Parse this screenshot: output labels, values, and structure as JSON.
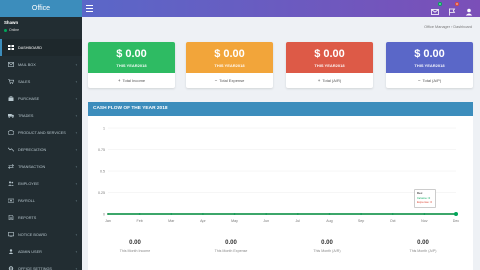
{
  "app": {
    "brand": "Office"
  },
  "user": {
    "name": "Shawn",
    "status": "Online"
  },
  "sidebar": {
    "items": [
      {
        "label": "DASHBOARD",
        "icon": "dashboard-icon",
        "active": true,
        "arrow": ""
      },
      {
        "label": "MAIL BOX",
        "icon": "mail-icon",
        "active": false,
        "arrow": "‹"
      },
      {
        "label": "SALES",
        "icon": "cart-icon",
        "active": false,
        "arrow": "‹"
      },
      {
        "label": "PURCHASE",
        "icon": "bag-icon",
        "active": false,
        "arrow": "‹"
      },
      {
        "label": "TRADES",
        "icon": "truck-icon",
        "active": false,
        "arrow": "‹"
      },
      {
        "label": "PRODUCT AND SERVICES",
        "icon": "box-icon",
        "active": false,
        "arrow": "‹"
      },
      {
        "label": "DEPRECIATION",
        "icon": "chart-down-icon",
        "active": false,
        "arrow": "‹"
      },
      {
        "label": "TRANSACTION",
        "icon": "exchange-icon",
        "active": false,
        "arrow": "‹"
      },
      {
        "label": "EMPLOYEE",
        "icon": "users-icon",
        "active": false,
        "arrow": "‹"
      },
      {
        "label": "PAYROLL",
        "icon": "money-icon",
        "active": false,
        "arrow": "‹"
      },
      {
        "label": "REPORTS",
        "icon": "report-icon",
        "active": false,
        "arrow": ""
      },
      {
        "label": "NOTICE BOARD",
        "icon": "board-icon",
        "active": false,
        "arrow": "‹"
      },
      {
        "label": "ADMIN USER",
        "icon": "user-icon",
        "active": false,
        "arrow": "‹"
      },
      {
        "label": "OFFICE SETTINGS",
        "icon": "gear-icon",
        "active": false,
        "arrow": "‹"
      }
    ]
  },
  "topbar": {
    "icons": [
      {
        "name": "mail-notification-icon",
        "badge": "0",
        "badge_color": "#00a65a"
      },
      {
        "name": "flag-notification-icon",
        "badge": "0",
        "badge_color": "#dd4b39"
      },
      {
        "name": "user-account-icon",
        "badge": "",
        "badge_color": ""
      }
    ]
  },
  "breadcrumb": "Office Manager › Dashboard",
  "stats": [
    {
      "amount": "$ 0.00",
      "period": "THIS YEAR2018",
      "label": "Total Income",
      "glyph": "+",
      "color": "#2ebb63"
    },
    {
      "amount": "$ 0.00",
      "period": "THIS YEAR2018",
      "label": "Total Expense",
      "glyph": "−",
      "color": "#f2a53a"
    },
    {
      "amount": "$ 0.00",
      "period": "THIS YEAR2018",
      "label": "Total (A/R)",
      "glyph": "+",
      "color": "#dd5a47"
    },
    {
      "amount": "$ 0.00",
      "period": "THIS YEAR2018",
      "label": "Total (A/P)",
      "glyph": "−",
      "color": "#5a67c8"
    }
  ],
  "cashflow": {
    "title": "CASH FLOW OF THE YEAR 2018",
    "tooltip": {
      "month": "Dec",
      "income": "Income: 0",
      "expense": "Expense: 0"
    }
  },
  "chart_data": {
    "type": "line",
    "categories": [
      "Jan",
      "Feb",
      "Mar",
      "Apr",
      "May",
      "Jun",
      "Jul",
      "Aug",
      "Sep",
      "Oct",
      "Nov",
      "Dec"
    ],
    "series": [
      {
        "name": "Income",
        "values": [
          0,
          0,
          0,
          0,
          0,
          0,
          0,
          0,
          0,
          0,
          0,
          0
        ],
        "color": "#00a65a"
      },
      {
        "name": "Expense",
        "values": [
          0,
          0,
          0,
          0,
          0,
          0,
          0,
          0,
          0,
          0,
          0,
          0
        ],
        "color": "#dd4b39"
      }
    ],
    "y_ticks": [
      "1",
      "0.75",
      "0.5",
      "0.25",
      "0"
    ],
    "ylim": [
      0,
      1
    ],
    "grid": "y"
  },
  "bottom_stats": [
    {
      "value": "0.00",
      "label": "This Month Income"
    },
    {
      "value": "0.00",
      "label": "This Month Expense"
    },
    {
      "value": "0.00",
      "label": "This Month (A/R)"
    },
    {
      "value": "0.00",
      "label": "This Month (A/P)"
    }
  ]
}
